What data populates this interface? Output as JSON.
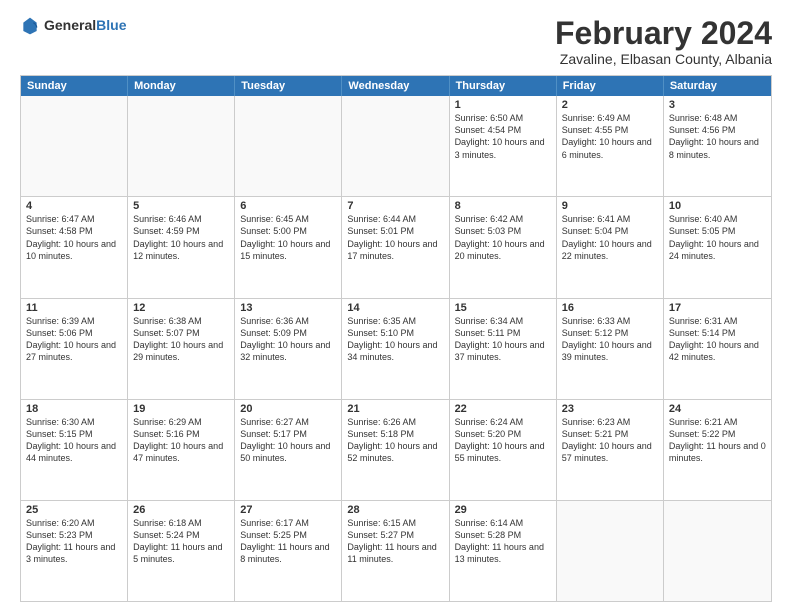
{
  "logo": {
    "general": "General",
    "blue": "Blue"
  },
  "header": {
    "month": "February 2024",
    "location": "Zavaline, Elbasan County, Albania"
  },
  "days_of_week": [
    "Sunday",
    "Monday",
    "Tuesday",
    "Wednesday",
    "Thursday",
    "Friday",
    "Saturday"
  ],
  "rows": [
    [
      {
        "day": "",
        "empty": true
      },
      {
        "day": "",
        "empty": true
      },
      {
        "day": "",
        "empty": true
      },
      {
        "day": "",
        "empty": true
      },
      {
        "day": "1",
        "text": "Sunrise: 6:50 AM\nSunset: 4:54 PM\nDaylight: 10 hours\nand 3 minutes."
      },
      {
        "day": "2",
        "text": "Sunrise: 6:49 AM\nSunset: 4:55 PM\nDaylight: 10 hours\nand 6 minutes."
      },
      {
        "day": "3",
        "text": "Sunrise: 6:48 AM\nSunset: 4:56 PM\nDaylight: 10 hours\nand 8 minutes."
      }
    ],
    [
      {
        "day": "4",
        "text": "Sunrise: 6:47 AM\nSunset: 4:58 PM\nDaylight: 10 hours\nand 10 minutes."
      },
      {
        "day": "5",
        "text": "Sunrise: 6:46 AM\nSunset: 4:59 PM\nDaylight: 10 hours\nand 12 minutes."
      },
      {
        "day": "6",
        "text": "Sunrise: 6:45 AM\nSunset: 5:00 PM\nDaylight: 10 hours\nand 15 minutes."
      },
      {
        "day": "7",
        "text": "Sunrise: 6:44 AM\nSunset: 5:01 PM\nDaylight: 10 hours\nand 17 minutes."
      },
      {
        "day": "8",
        "text": "Sunrise: 6:42 AM\nSunset: 5:03 PM\nDaylight: 10 hours\nand 20 minutes."
      },
      {
        "day": "9",
        "text": "Sunrise: 6:41 AM\nSunset: 5:04 PM\nDaylight: 10 hours\nand 22 minutes."
      },
      {
        "day": "10",
        "text": "Sunrise: 6:40 AM\nSunset: 5:05 PM\nDaylight: 10 hours\nand 24 minutes."
      }
    ],
    [
      {
        "day": "11",
        "text": "Sunrise: 6:39 AM\nSunset: 5:06 PM\nDaylight: 10 hours\nand 27 minutes."
      },
      {
        "day": "12",
        "text": "Sunrise: 6:38 AM\nSunset: 5:07 PM\nDaylight: 10 hours\nand 29 minutes."
      },
      {
        "day": "13",
        "text": "Sunrise: 6:36 AM\nSunset: 5:09 PM\nDaylight: 10 hours\nand 32 minutes."
      },
      {
        "day": "14",
        "text": "Sunrise: 6:35 AM\nSunset: 5:10 PM\nDaylight: 10 hours\nand 34 minutes."
      },
      {
        "day": "15",
        "text": "Sunrise: 6:34 AM\nSunset: 5:11 PM\nDaylight: 10 hours\nand 37 minutes."
      },
      {
        "day": "16",
        "text": "Sunrise: 6:33 AM\nSunset: 5:12 PM\nDaylight: 10 hours\nand 39 minutes."
      },
      {
        "day": "17",
        "text": "Sunrise: 6:31 AM\nSunset: 5:14 PM\nDaylight: 10 hours\nand 42 minutes."
      }
    ],
    [
      {
        "day": "18",
        "text": "Sunrise: 6:30 AM\nSunset: 5:15 PM\nDaylight: 10 hours\nand 44 minutes."
      },
      {
        "day": "19",
        "text": "Sunrise: 6:29 AM\nSunset: 5:16 PM\nDaylight: 10 hours\nand 47 minutes."
      },
      {
        "day": "20",
        "text": "Sunrise: 6:27 AM\nSunset: 5:17 PM\nDaylight: 10 hours\nand 50 minutes."
      },
      {
        "day": "21",
        "text": "Sunrise: 6:26 AM\nSunset: 5:18 PM\nDaylight: 10 hours\nand 52 minutes."
      },
      {
        "day": "22",
        "text": "Sunrise: 6:24 AM\nSunset: 5:20 PM\nDaylight: 10 hours\nand 55 minutes."
      },
      {
        "day": "23",
        "text": "Sunrise: 6:23 AM\nSunset: 5:21 PM\nDaylight: 10 hours\nand 57 minutes."
      },
      {
        "day": "24",
        "text": "Sunrise: 6:21 AM\nSunset: 5:22 PM\nDaylight: 11 hours\nand 0 minutes."
      }
    ],
    [
      {
        "day": "25",
        "text": "Sunrise: 6:20 AM\nSunset: 5:23 PM\nDaylight: 11 hours\nand 3 minutes."
      },
      {
        "day": "26",
        "text": "Sunrise: 6:18 AM\nSunset: 5:24 PM\nDaylight: 11 hours\nand 5 minutes."
      },
      {
        "day": "27",
        "text": "Sunrise: 6:17 AM\nSunset: 5:25 PM\nDaylight: 11 hours\nand 8 minutes."
      },
      {
        "day": "28",
        "text": "Sunrise: 6:15 AM\nSunset: 5:27 PM\nDaylight: 11 hours\nand 11 minutes."
      },
      {
        "day": "29",
        "text": "Sunrise: 6:14 AM\nSunset: 5:28 PM\nDaylight: 11 hours\nand 13 minutes."
      },
      {
        "day": "",
        "empty": true
      },
      {
        "day": "",
        "empty": true
      }
    ]
  ]
}
